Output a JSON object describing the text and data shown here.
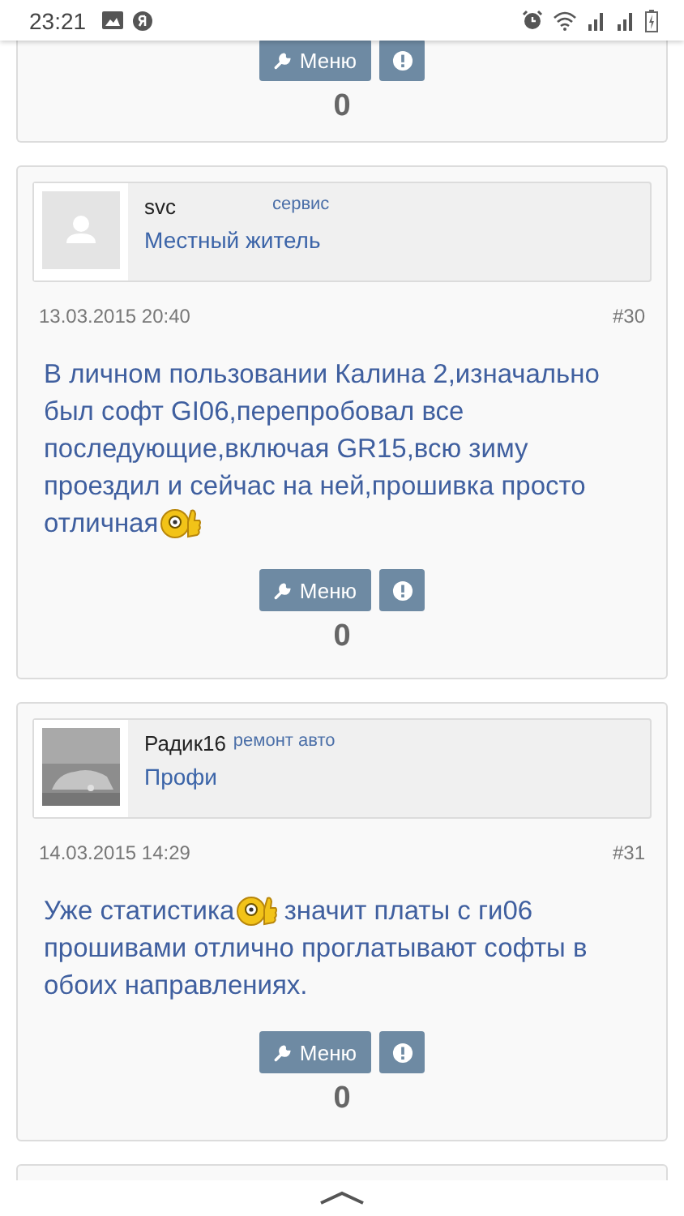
{
  "status_bar": {
    "time": "23:21"
  },
  "top_post": {
    "menu_label": "Меню",
    "count": "0"
  },
  "posts": [
    {
      "author": "svc",
      "title": "сервис",
      "rank": "Местный житель",
      "avatar": {
        "kind": "placeholder"
      },
      "date": "13.03.2015 20:40",
      "number": "#30",
      "body_before": "В личном пользовании Калина 2,изначально был софт GI06,перепробовал все последующие,включая GR15,всю зиму проездил и сейчас на ней,прошивка просто отличная",
      "menu_label": "Меню",
      "count": "0"
    },
    {
      "author": "Радик16",
      "title": "ремонт авто",
      "rank": "Профи",
      "date": "14.03.2015 14:29",
      "number": "#31",
      "body_before": "Уже статистика",
      "body_after": " значит платы с ги06 прошивами отлично проглатывают софты в обоих направлениях.",
      "menu_label": "Меню",
      "count": "0"
    }
  ]
}
